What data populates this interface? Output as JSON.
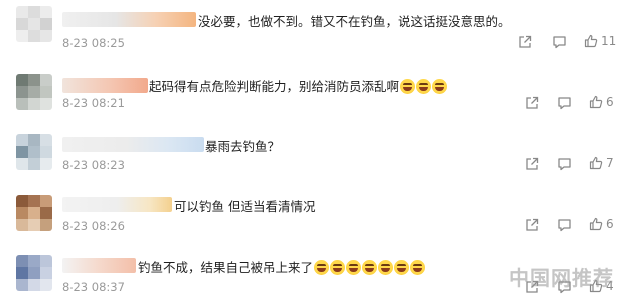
{
  "comments": [
    {
      "text": "没必要，也做不到。错又不在钓鱼，说这话挺没意思的。",
      "time": "8-23 08:25",
      "likes": "11",
      "emoji_count": 0
    },
    {
      "text": "起码得有点危险判断能力，别给消防员添乱啊",
      "time": "8-23 08:21",
      "likes": "6",
      "emoji_count": 3
    },
    {
      "text": "暴雨去钓鱼？",
      "time": "8-23 08:23",
      "likes": "7",
      "emoji_count": 0
    },
    {
      "text": "可以钓鱼 但适当看清情况",
      "time": "8-23 08:26",
      "likes": "6",
      "emoji_count": 0
    },
    {
      "text": "钓鱼不成，结果自己被吊上来了",
      "time": "8-23 08:37",
      "likes": "4",
      "emoji_count": 7
    }
  ],
  "watermark": "中国网推荐",
  "icons": {
    "share": "share-icon",
    "comment": "comment-icon",
    "like": "thumbs-up-icon"
  }
}
